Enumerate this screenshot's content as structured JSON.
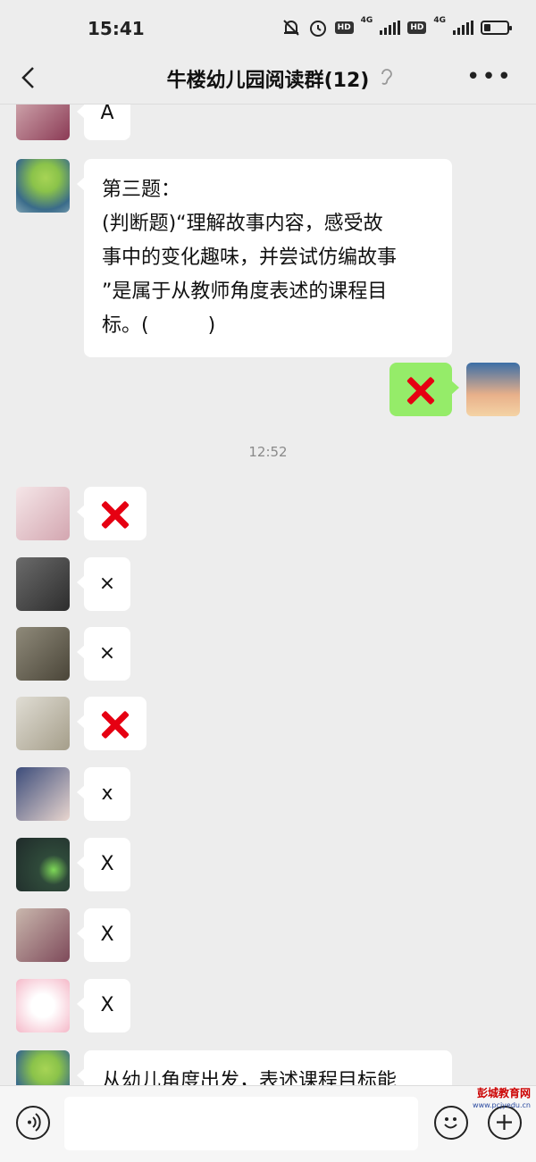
{
  "status": {
    "time": "15:41",
    "network1": "4G",
    "network2": "4G",
    "hd": "HD",
    "battery_level": 0.3
  },
  "header": {
    "title": "牛楼幼儿园阅读群(12)"
  },
  "messages": {
    "m0": "A",
    "m1_lines": [
      "第三题：",
      "(判断题)“理解故事内容，感受故",
      "事中的变化趣味，并尝试仿编故事",
      "”是属于从教师角度表述的课程目",
      "标。(　　　)"
    ],
    "timestamp": "12:52",
    "m5": "×",
    "m6": "×",
    "m8": "x",
    "m9": "X",
    "m10": "X",
    "m11": "X",
    "m12": "从幼儿角度出发，表述课程目标能"
  },
  "watermark": {
    "name": "彭城教育网",
    "url": "www.pcjyedu.cn"
  },
  "colors": {
    "background": "#ededed",
    "mine_bubble": "#95ec69",
    "cross_red": "#e60012"
  }
}
